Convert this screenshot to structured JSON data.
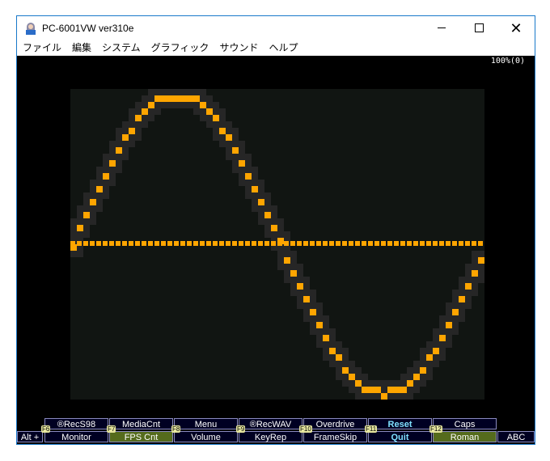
{
  "window": {
    "title": "PC-6001VW ver310e"
  },
  "menu": [
    "ファイル",
    "編集",
    "システム",
    "グラフィック",
    "サウンド",
    "ヘルプ"
  ],
  "screen": {
    "status": "100%(0)",
    "colors": {
      "wave": "#ffa500",
      "panel": "#111512",
      "shadow": "#262626",
      "background": "#000000"
    }
  },
  "fkeys": {
    "alt": "Alt +",
    "upper": [
      "®RecS98",
      "MediaCnt",
      "Menu",
      "®RecWAV",
      "Overdrive",
      "Reset",
      "Caps"
    ],
    "lower": [
      "Monitor",
      "FPS Cnt",
      "Volume",
      "KeyRep",
      "FrameSkip",
      "Quit",
      "Roman",
      "ABC"
    ],
    "labels": [
      "F6",
      "F7",
      "F8",
      "F9",
      "F10",
      "F11",
      "F12"
    ]
  }
}
